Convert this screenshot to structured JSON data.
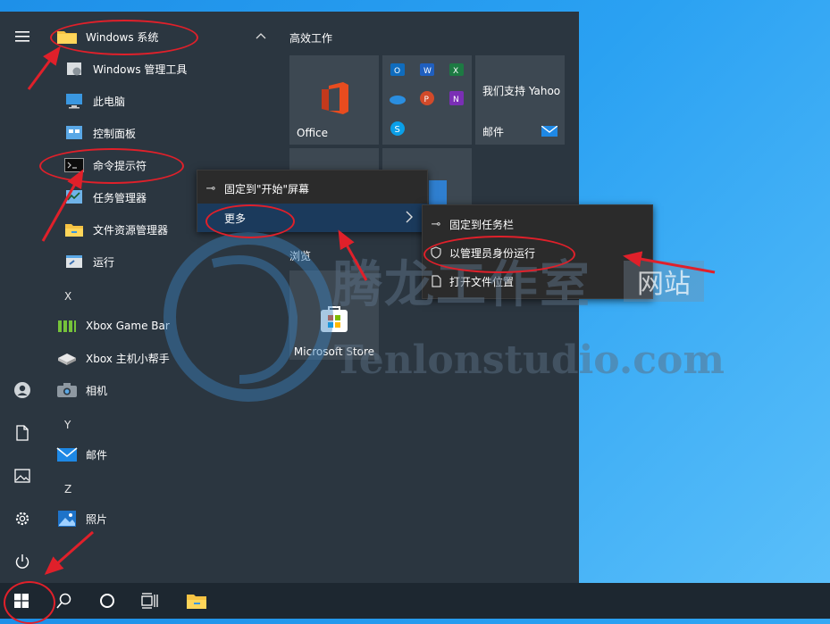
{
  "start_menu": {
    "applist": {
      "folder_label": "Windows 系统",
      "items": [
        {
          "label": "Windows 管理工具",
          "icon": "admin-tools-icon"
        },
        {
          "label": "此电脑",
          "icon": "this-pc-icon"
        },
        {
          "label": "控制面板",
          "icon": "control-panel-icon"
        },
        {
          "label": "命令提示符",
          "icon": "cmd-icon"
        },
        {
          "label": "任务管理器",
          "icon": "task-manager-icon"
        },
        {
          "label": "文件资源管理器",
          "icon": "file-explorer-icon"
        },
        {
          "label": "运行",
          "icon": "run-icon"
        }
      ],
      "letter_x": "X",
      "items_x": [
        {
          "label": "Xbox Game Bar",
          "icon": "xbox-game-bar-icon"
        },
        {
          "label": "Xbox 主机小帮手",
          "icon": "xbox-companion-icon"
        },
        {
          "label": "相机",
          "icon": "camera-icon"
        }
      ],
      "letter_y": "Y",
      "items_y": [
        {
          "label": "邮件",
          "icon": "mail-icon"
        }
      ],
      "letter_z": "Z",
      "items_z": [
        {
          "label": "照片",
          "icon": "photos-icon"
        }
      ]
    },
    "tiles": {
      "group_title": "高效工作",
      "office_label": "Office",
      "yahoo_label": "我们支持 Yahoo",
      "mail_label": "邮件",
      "browse_label": "浏览",
      "store_label": "Microsoft Store"
    }
  },
  "context_menu": {
    "pin_start": "固定到\"开始\"屏幕",
    "more": "更多"
  },
  "submenu": {
    "pin_taskbar": "固定到任务栏",
    "run_admin": "以管理员身份运行",
    "open_location": "打开文件位置"
  },
  "watermark": {
    "cn": "腾龙工作室",
    "site": "网站",
    "en": "Tenlonstudio.com"
  },
  "colors": {
    "annotation": "#e0202a",
    "menu_bg": "#2b3640",
    "tile_bg": "#3d4852",
    "desktop": "#2aa1f2"
  }
}
